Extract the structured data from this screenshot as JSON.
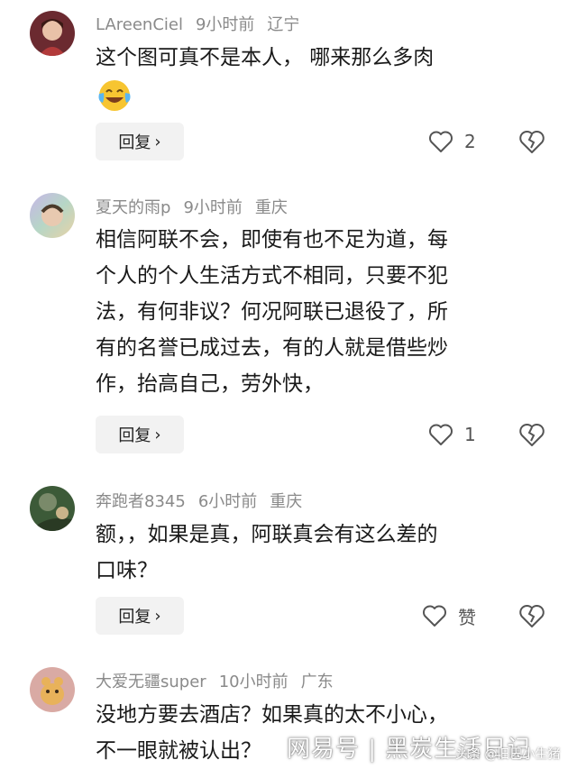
{
  "comments": [
    {
      "user": "LAreenCiel",
      "time": "9小时前",
      "location": "辽宁",
      "lines": [
        "这个图可真不是本人， 哪来那么多肉"
      ],
      "reply_label": "回复",
      "like_count": "2",
      "emoji": "laughing-tears-emoji",
      "avatar_color": "#7a2b35"
    },
    {
      "user": "夏天的雨p",
      "time": "9小时前",
      "location": "重庆",
      "lines": [
        "相信阿联不会，即使有也不足为道，每",
        "个人的个人生活方式不相同，只要不犯",
        "法，有何非议？何况阿联已退役了，所",
        "有的名誉已成过去，有的人就是借些炒",
        "作，抬高自己，劳外快，"
      ],
      "reply_label": "回复",
      "like_count": "1",
      "avatar_color": "#9fb1d8"
    },
    {
      "user": "奔跑者8345",
      "time": "6小时前",
      "location": "重庆",
      "lines": [
        "额，，如果是真，阿联真会有这么差的",
        "口味？"
      ],
      "reply_label": "回复",
      "like_count": "赞",
      "avatar_color": "#4a6b3d"
    },
    {
      "user": "大爱无疆super",
      "time": "10小时前",
      "location": "广东",
      "lines": [
        "没地方要去酒店？如果真的太不小心，",
        "不一眼就被认出？"
      ],
      "avatar_color": "#d7a8a0"
    }
  ],
  "watermark": {
    "main": "网易号 | 黑炭生活日记",
    "sub": "头条 @旧巴小生猪"
  },
  "colors": {
    "meta": "#8a8a8a",
    "button_bg": "#f2f2f2",
    "text": "#1a1a1a"
  }
}
